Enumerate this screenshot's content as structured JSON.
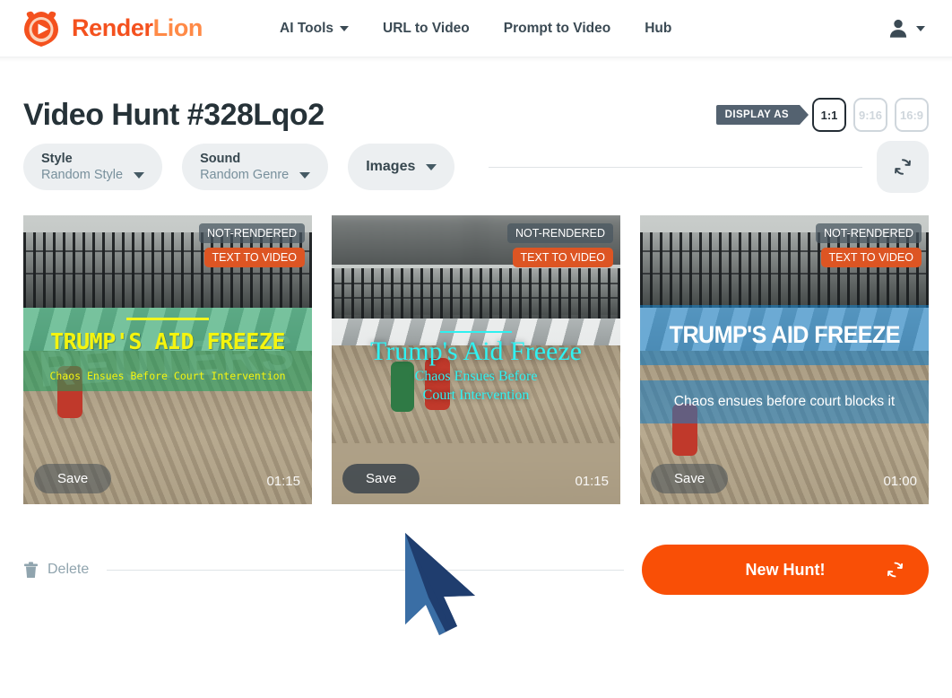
{
  "header": {
    "brand": {
      "part1": "Render",
      "part2": "Lion",
      "logo_icon": "lion-play-logo"
    },
    "nav": [
      {
        "label": "AI Tools",
        "has_caret": true
      },
      {
        "label": "URL to Video",
        "has_caret": false
      },
      {
        "label": "Prompt to Video",
        "has_caret": false
      },
      {
        "label": "Hub",
        "has_caret": false
      }
    ],
    "account": {
      "icon": "user-account-icon",
      "caret_icon": "chevron-down-icon"
    }
  },
  "page": {
    "title": "Video Hunt #328Lqo2",
    "display_as": {
      "tag": "DISPLAY AS",
      "options": [
        {
          "label": "1:1",
          "active": true
        },
        {
          "label": "9:16",
          "active": false
        },
        {
          "label": "16:9",
          "active": false
        }
      ]
    }
  },
  "filters": {
    "style": {
      "label": "Style",
      "value": "Random Style"
    },
    "sound": {
      "label": "Sound",
      "value": "Random Genre"
    },
    "images": {
      "label": "Images"
    },
    "refresh_icon": "refresh-icon"
  },
  "cards": [
    {
      "badge_status": "NOT-RENDERED",
      "badge_type": "TEXT TO VIDEO",
      "headline": "TRUMP'S AID FREEZE",
      "subtitle": "Chaos Ensues Before Court Intervention",
      "save_label": "Save",
      "duration": "01:15",
      "watermark": "REUTERS",
      "band_color": "#18a05c",
      "text_color": "#f4f40f"
    },
    {
      "badge_status": "NOT-RENDERED",
      "badge_type": "TEXT TO VIDEO",
      "headline": "Trump's Aid Freeze",
      "subtitle": "Chaos Ensues Before Court Intervention",
      "save_label": "Save",
      "duration": "01:15",
      "watermark": "",
      "band_color": "transparent",
      "text_color": "#2ff2f2"
    },
    {
      "badge_status": "NOT-RENDERED",
      "badge_type": "TEXT TO VIDEO",
      "headline": "TRUMP'S AID FREEZE",
      "subtitle": "Chaos ensues before court blocks it",
      "save_label": "Save",
      "duration": "01:00",
      "watermark": "",
      "band_color": "#187ec4",
      "text_color": "#ffffff"
    }
  ],
  "footer": {
    "delete_label": "Delete",
    "delete_icon": "trash-icon",
    "new_hunt_label": "New Hunt!",
    "new_hunt_icon": "refresh-icon"
  },
  "cursor": {
    "icon": "mouse-pointer-cursor"
  },
  "colors": {
    "brand_orange_dark": "#f4511e",
    "brand_orange_light": "#ff8a47",
    "cta_orange": "#f94f06",
    "badge_orange": "#dd5523",
    "slate": "#546270",
    "muted": "#90a4ae"
  }
}
